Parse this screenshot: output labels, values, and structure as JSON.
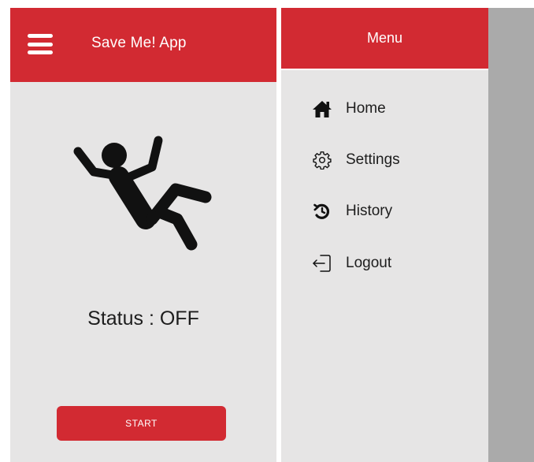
{
  "left_screen": {
    "app_title": "Save Me! App",
    "status_text": "Status : OFF",
    "start_label": "START",
    "icons": {
      "menu": "hamburger-menu-icon",
      "illustration": "person-falling-icon"
    }
  },
  "drawer": {
    "title": "Menu",
    "items": [
      {
        "label": "Home",
        "icon": "home-icon"
      },
      {
        "label": "Settings",
        "icon": "gear-icon"
      },
      {
        "label": "History",
        "icon": "history-icon"
      },
      {
        "label": "Logout",
        "icon": "logout-icon"
      }
    ]
  },
  "colors": {
    "accent": "#d22a32",
    "background": "#e6e5e5",
    "scrim": "#aaaaaa",
    "text": "#1d1d1d",
    "on_accent": "#ffffff"
  }
}
